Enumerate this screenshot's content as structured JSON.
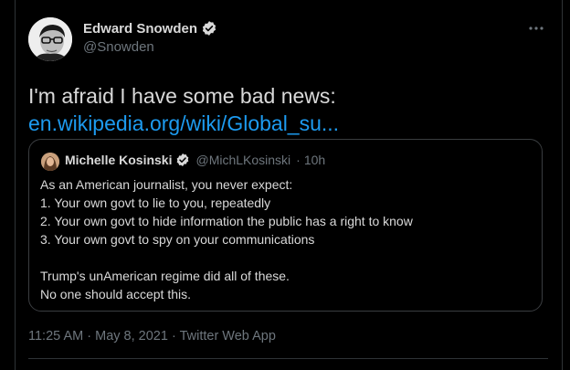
{
  "author": {
    "name": "Edward Snowden",
    "handle": "@Snowden",
    "verified_icon": "verified-badge-icon",
    "avatar_icon": "avatar-image"
  },
  "tweet": {
    "text_prefix": "I'm afraid I have some bad news: ",
    "link_text": "en.wikipedia.org/wiki/Global_su...",
    "link_color": "#1d9bf0"
  },
  "quoted": {
    "name": "Michelle Kosinski",
    "handle": "@MichLKosinski",
    "separator": "·",
    "time": "10h",
    "body": "As an American journalist, you never expect:\n1. Your own govt to lie to you, repeatedly\n2. Your own govt to hide information the public has a right to know\n3. Your own govt to spy on your communications\n\nTrump's unAmerican regime did all of these.\nNo one should accept this."
  },
  "footer": {
    "time": "11:25 AM",
    "dot1": "·",
    "date": "May 8, 2021",
    "dot2": "·",
    "source": "Twitter Web App"
  },
  "more_icon": "more-horizontal-icon",
  "colors": {
    "background": "#000000",
    "text": "#d9d9d9",
    "secondary": "#6e767d",
    "border": "#2f3336",
    "verified": "#d9d9d9"
  }
}
